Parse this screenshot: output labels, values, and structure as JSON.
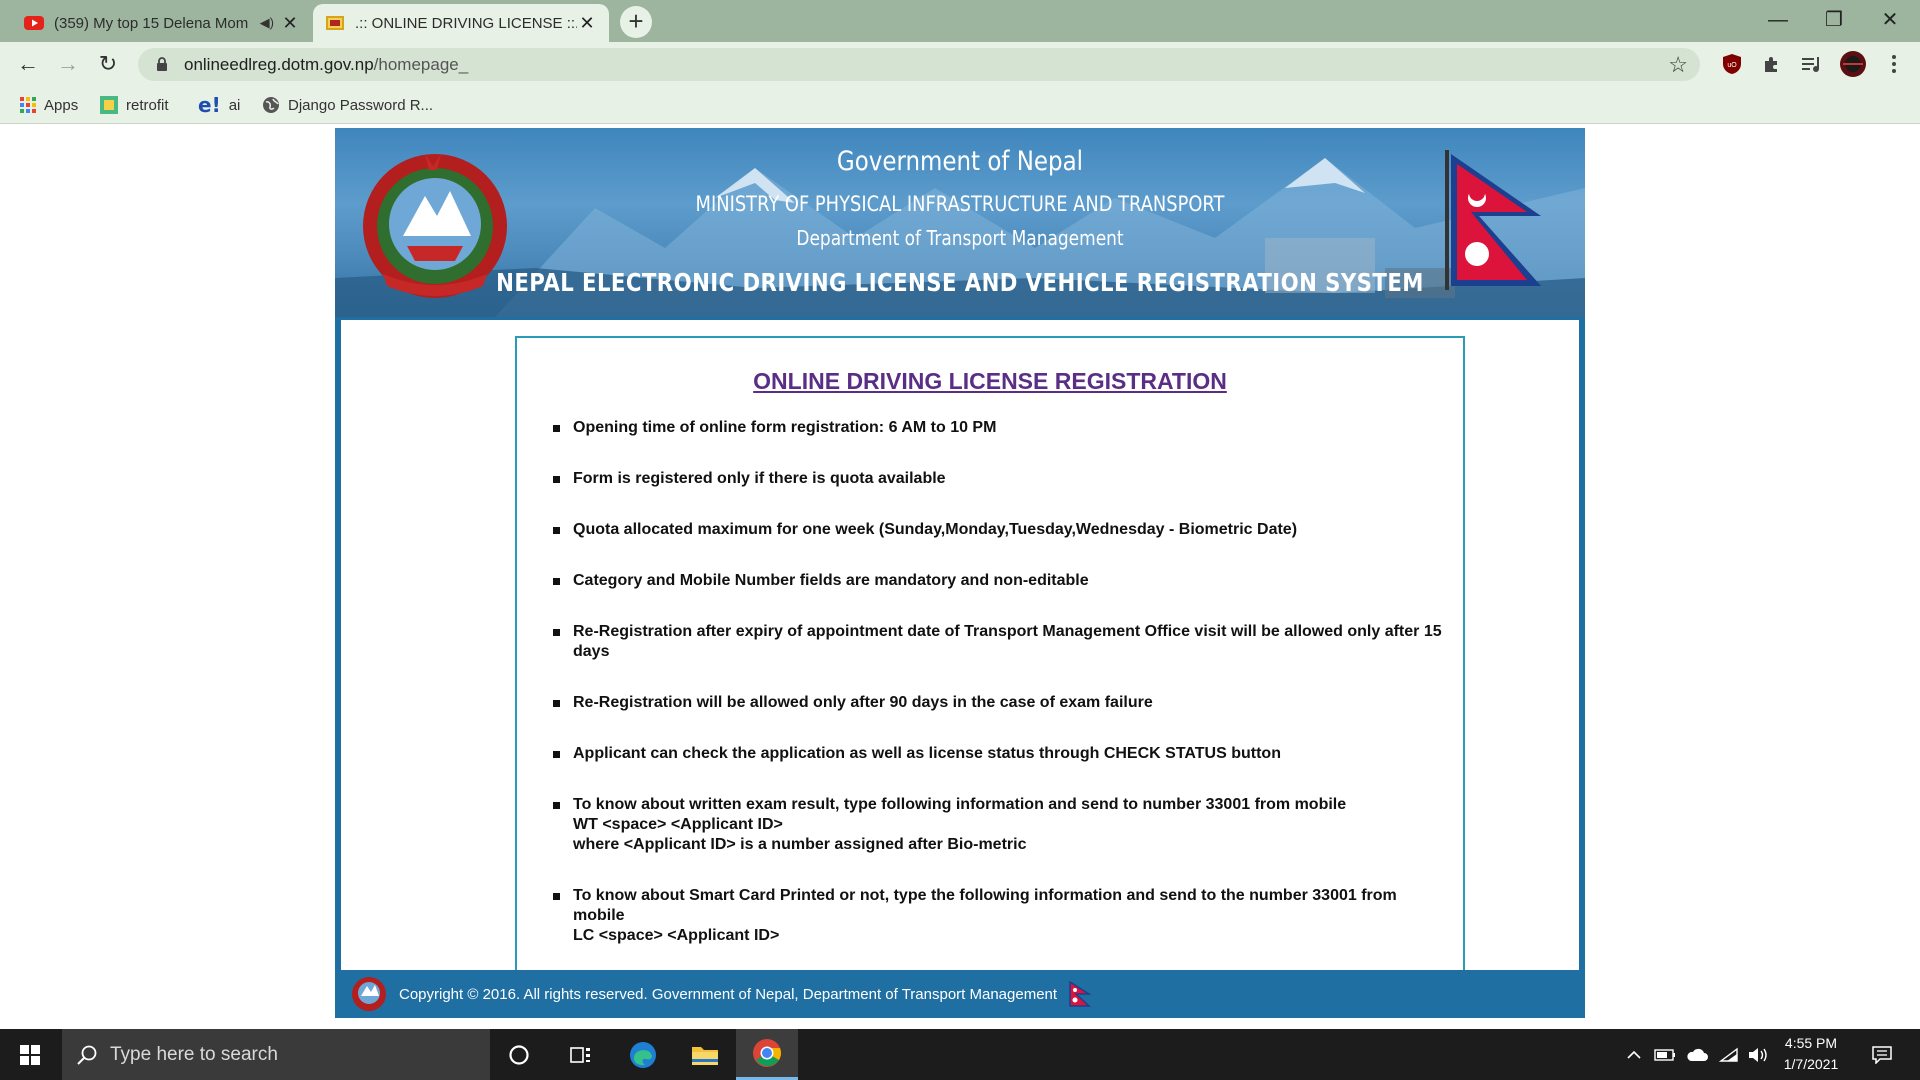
{
  "browser": {
    "tabs": [
      {
        "title": "(359) My top 15 Delena Mom",
        "muted_icon": "speaker-icon",
        "close": "✕"
      },
      {
        "title": ".:: ONLINE DRIVING LICENSE ::.",
        "close": "✕"
      }
    ],
    "new_tab": "+",
    "window_controls": {
      "minimize": "—",
      "restore": "❐",
      "close": "✕"
    },
    "address": {
      "host": "onlineedlreg.dotm.gov.np",
      "path": "/homepage_"
    },
    "bookmarks": [
      {
        "label": "Apps"
      },
      {
        "label": "retrofit"
      },
      {
        "label": "ai"
      },
      {
        "label": "Django Password R..."
      }
    ]
  },
  "site": {
    "header": {
      "government": "Government of Nepal",
      "ministry": "MINISTRY OF PHYSICAL INFRASTRUCTURE AND TRANSPORT",
      "department": "Department of Transport Management",
      "system": "NEPAL ELECTRONIC DRIVING LICENSE AND VEHICLE REGISTRATION SYSTEM"
    },
    "notice": {
      "title": "ONLINE DRIVING LICENSE REGISTRATION",
      "rules": [
        {
          "text": "Opening time of online form registration: 6 AM to 10 PM"
        },
        {
          "text": "Form is registered only if there is quota available"
        },
        {
          "text": "Quota allocated maximum for one week (Sunday,Monday,Tuesday,Wednesday - Biometric Date)"
        },
        {
          "text": "Category and Mobile Number fields are mandatory and non-editable"
        },
        {
          "text": "Re-Registration after expiry of appointment date of Transport Management Office visit will be allowed only after 15 days"
        },
        {
          "text": "Re-Registration will be allowed only after 90 days in the case of exam failure"
        },
        {
          "text": "Applicant can check the application as well as license status through CHECK STATUS button"
        },
        {
          "text": "To know about written exam result, type following information and send to number 33001 from mobile",
          "line2": "WT <space> <Applicant ID>",
          "line3": "where <Applicant ID> is a number assigned after Bio-metric"
        },
        {
          "text": "To know about Smart Card Printed or not, type the following information and send to the number 33001 from mobile",
          "line2": "LC <space> <Applicant ID>"
        }
      ]
    },
    "footer": "Copyright © 2016. All rights reserved. Government of Nepal, Department of Transport Management"
  },
  "taskbar": {
    "search_placeholder": "Type here to search",
    "time": "4:55 PM",
    "date": "1/7/2021"
  },
  "colors": {
    "header_blue": "#1f6fa3",
    "title_purple": "#5b2e86",
    "notice_border": "#2a9bb6",
    "tabbar_green": "#9db59f"
  }
}
